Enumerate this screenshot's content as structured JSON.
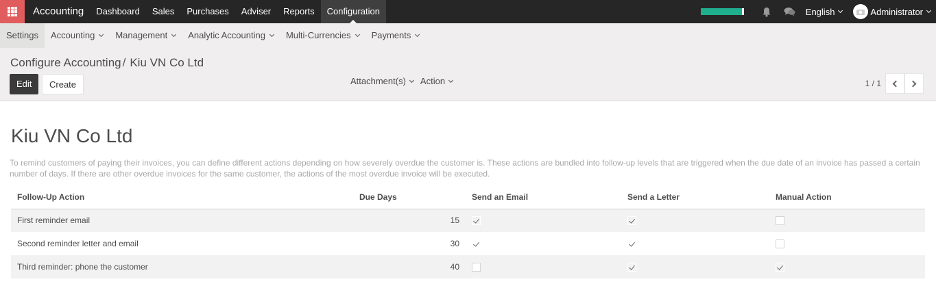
{
  "topbar": {
    "brand": "Accounting",
    "menu": [
      "Dashboard",
      "Sales",
      "Purchases",
      "Adviser",
      "Reports",
      "Configuration"
    ],
    "active": "Configuration",
    "progress_fraction": 0.95,
    "language": "English",
    "user": "Administrator",
    "accent_color": "#e15d5d",
    "icons": [
      "apps-grid-icon",
      "bell-icon",
      "chat-icon",
      "user-avatar-icon"
    ]
  },
  "secondary_menu": {
    "items": [
      "Settings",
      "Accounting",
      "Management",
      "Analytic Accounting",
      "Multi-Currencies",
      "Payments"
    ]
  },
  "control_panel": {
    "breadcrumb_parent": "Configure Accounting",
    "breadcrumb_sep": "/",
    "breadcrumb_current": "Kiu VN Co Ltd",
    "edit_label": "Edit",
    "create_label": "Create",
    "attachments_label": "Attachment(s)",
    "action_label": "Action",
    "pager": "1 / 1"
  },
  "sheet": {
    "title": "Kiu VN Co Ltd",
    "help_text": "To remind customers of paying their invoices, you can define different actions depending on how severely overdue the customer is. These actions are bundled into follow-up levels that are triggered when the due date of an invoice has passed a certain number of days. If there are other overdue invoices for the same customer, the actions of the most overdue invoice will be executed.",
    "columns": [
      "Follow-Up Action",
      "Due Days",
      "Send an Email",
      "Send a Letter",
      "Manual Action"
    ],
    "rows": [
      {
        "action": "First reminder email",
        "due_days": "15",
        "email": true,
        "letter": true,
        "manual": false
      },
      {
        "action": "Second reminder letter and email",
        "due_days": "30",
        "email": true,
        "letter": true,
        "manual": false
      },
      {
        "action": "Third reminder: phone the customer",
        "due_days": "40",
        "email": false,
        "letter": true,
        "manual": true
      }
    ]
  }
}
